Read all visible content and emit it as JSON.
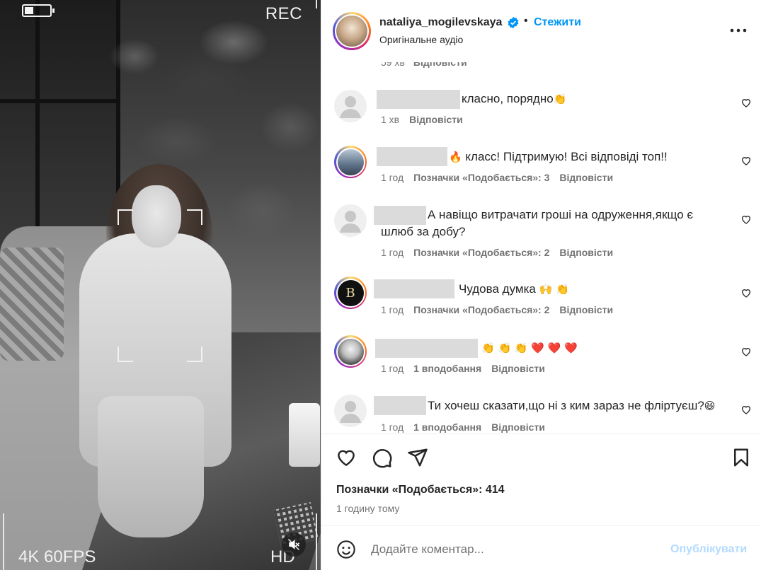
{
  "video": {
    "rec_label": "REC",
    "resolution_label": "4K 60FPS",
    "quality_label": "HD"
  },
  "header": {
    "username": "nataliya_mogilevskaya",
    "follow_label": "Стежити",
    "separator": "•",
    "audio_label": "Оригінальне аудіо"
  },
  "clipped_meta": {
    "time": "59 хв",
    "reply": "Відповісти"
  },
  "comments": [
    {
      "text": "класно, порядно",
      "emoji": "👏",
      "time": "1 хв",
      "likes": "",
      "reply": "Відповісти"
    },
    {
      "prefix_emoji": "🔥",
      "text": "класс! Підтримую! Всі відповіді топ!!",
      "time": "1 год",
      "likes": "Позначки «Подобається»: 3",
      "reply": "Відповісти"
    },
    {
      "text_line1": "А навіщо витрачати гроші на одруження,якщо є",
      "text_line2": "шлюб за добу?",
      "time": "1 год",
      "likes": "Позначки «Подобається»: 2",
      "reply": "Відповісти"
    },
    {
      "text": "Чудова думка",
      "emoji": "🙌 👏",
      "avatar_letter": "B",
      "time": "1 год",
      "likes": "Позначки «Подобається»: 2",
      "reply": "Відповісти"
    },
    {
      "emoji": "👏 👏 👏 ❤️ ❤️ ❤️",
      "time": "1 год",
      "likes": "1 вподобання",
      "reply": "Відповісти"
    },
    {
      "text": "Ти хочеш сказати,що ні з ким зараз не фліртуєш?",
      "emoji": "😆",
      "time": "1 год",
      "likes": "1 вподобання",
      "reply": "Відповісти"
    }
  ],
  "post": {
    "likes_label": "Позначки «Подобається»: 414",
    "time_label": "1 годину тому"
  },
  "add_comment": {
    "placeholder": "Додайте коментар...",
    "publish_label": "Опублікувати"
  },
  "colors": {
    "accent": "#0095f6",
    "publish_disabled": "#b3dbff",
    "muted_text": "#737373",
    "redaction": "#dbdbdb"
  },
  "icons": [
    "battery-icon",
    "mute-icon",
    "verified-icon",
    "more-icon",
    "heart-icon",
    "comment-icon",
    "share-icon",
    "bookmark-icon",
    "emoji-icon",
    "default-avatar-icon"
  ]
}
